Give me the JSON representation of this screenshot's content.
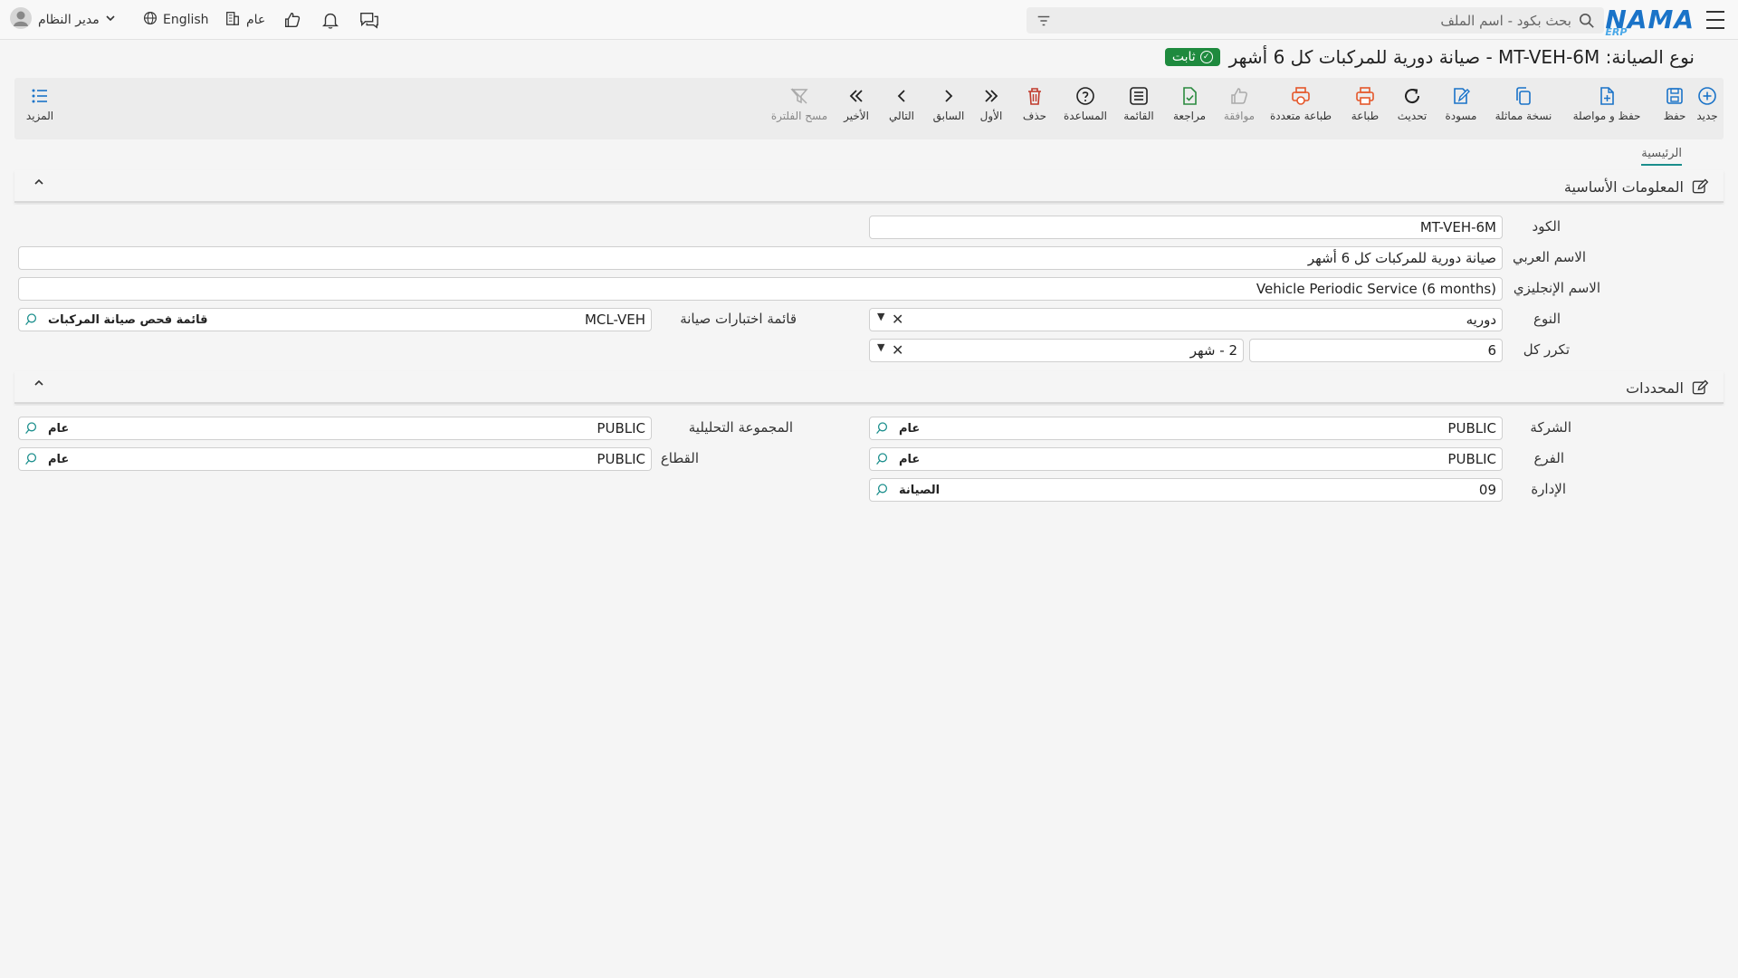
{
  "app": {
    "brand": "NAMA",
    "brand_sub": "ERP",
    "search_placeholder": "بحث بكود - اسم الملف"
  },
  "topbar": {
    "user": "مدير النظام",
    "language": "English",
    "company": "عام"
  },
  "page": {
    "title": "نوع الصيانة: MT-VEH-6M - صيانة دورية للمركبات كل 6 أشهر",
    "status": "ثابت"
  },
  "toolbar": {
    "new": "جديد",
    "save": "حفظ",
    "save_continue": "حفظ و مواصلة",
    "duplicate": "نسخة مماثلة",
    "draft": "مسودة",
    "refresh": "تحديث",
    "print": "طباعة",
    "multi_print": "طباعة متعددة",
    "approve": "موافقة",
    "review": "مراجعة",
    "list": "القائمة",
    "help": "المساعدة",
    "delete": "حذف",
    "first": "الأول",
    "previous": "السابق",
    "next": "التالي",
    "last": "الأخير",
    "clear_filter": "مسح الفلترة",
    "more": "المزيد"
  },
  "tabs": {
    "main": "الرئيسية"
  },
  "sections": {
    "basic": {
      "title": "المعلومات الأساسية",
      "code_label": "الكود",
      "code": "MT-VEH-6M",
      "arabic_name_label": "الاسم العربي",
      "arabic_name": "صيانة دورية للمركبات كل 6 أشهر",
      "english_name_label": "الاسم الإنجليزي",
      "english_name": "Vehicle Periodic Service (6 months)",
      "type_label": "النوع",
      "type": "دوريه",
      "checklist_label": "قائمة اختبارات صيانة",
      "checklist_code": "MCL-VEH",
      "checklist_name": "قائمة فحص صيانة المركبات",
      "repeat_label": "تكرر كل",
      "repeat_value": "6",
      "repeat_unit": "2 - شهر"
    },
    "dimensions": {
      "title": "المحددات",
      "company_label": "الشركة",
      "company_code": "PUBLIC",
      "company_name": "عام",
      "analytic_label": "المجموعة التحليلية",
      "analytic_code": "PUBLIC",
      "analytic_name": "عام",
      "branch_label": "الفرع",
      "branch_code": "PUBLIC",
      "branch_name": "عام",
      "sector_label": "القطاع",
      "sector_code": "PUBLIC",
      "sector_name": "عام",
      "department_label": "الإدارة",
      "department_code": "09",
      "department_name": "الصيانة"
    }
  },
  "colors": {
    "accent": "#1a73c8",
    "status": "#1e8a3e",
    "tab_underline": "#1a8e8c"
  }
}
